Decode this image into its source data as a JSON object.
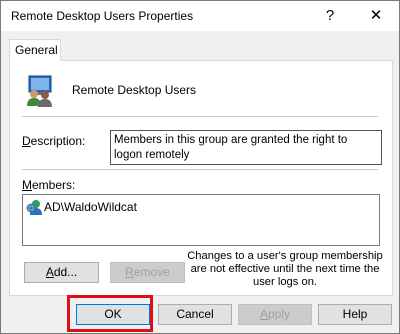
{
  "window": {
    "title": "Remote Desktop Users Properties",
    "help_glyph": "?",
    "close_glyph": "✕"
  },
  "tabs": [
    {
      "label": "General"
    }
  ],
  "group": {
    "name": "Remote Desktop Users",
    "icon": "group-users-icon"
  },
  "description": {
    "label": "Description:",
    "value": "Members in this group are granted the right to logon remotely"
  },
  "members": {
    "label": "Members:",
    "items": [
      {
        "name": "AD\\WaldoWildcat",
        "icon": "user-icon"
      }
    ]
  },
  "buttons": {
    "add": "Add...",
    "remove": "Remove",
    "ok": "OK",
    "cancel": "Cancel",
    "apply": "Apply",
    "help": "Help"
  },
  "note": "Changes to a user's group membership are not effective until the next time the user logs on.",
  "colors": {
    "highlight": "#e0101a"
  }
}
